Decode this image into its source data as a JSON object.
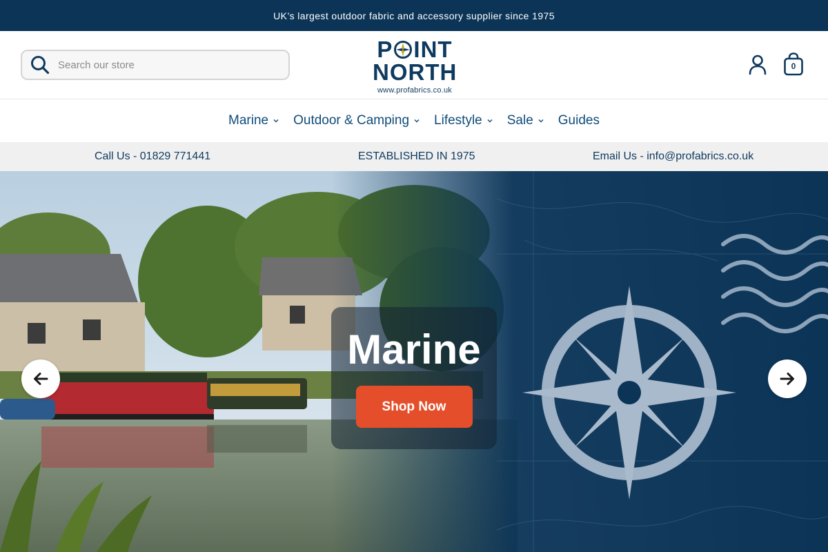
{
  "announcement": {
    "text": "UK’s largest outdoor fabric and accessory supplier since 1975"
  },
  "header": {
    "search": {
      "placeholder": "Search our store",
      "value": ""
    },
    "logo": {
      "word1_left": "P",
      "word1_right": "INT",
      "word2": "NORTH",
      "url": "www.profabrics.co.uk"
    },
    "cart_count": "0"
  },
  "nav": {
    "items": [
      {
        "label": "Marine",
        "has_dropdown": true
      },
      {
        "label": "Outdoor & Camping",
        "has_dropdown": true
      },
      {
        "label": "Lifestyle",
        "has_dropdown": true
      },
      {
        "label": "Sale",
        "has_dropdown": true
      },
      {
        "label": "Guides",
        "has_dropdown": false
      }
    ]
  },
  "infobar": {
    "call": "Call Us - 01829 771441",
    "established": "ESTABLISHED IN 1975",
    "email": "Email Us - info@profabrics.co.uk"
  },
  "hero": {
    "title": "Marine",
    "cta_label": "Shop Now",
    "prev_icon": "arrow-left-icon",
    "next_icon": "arrow-right-icon"
  },
  "colors": {
    "brand_navy": "#0b3457",
    "nav_text": "#0f4c7a",
    "cta": "#e54e2a",
    "infobar_bg": "#f0f0f0"
  }
}
